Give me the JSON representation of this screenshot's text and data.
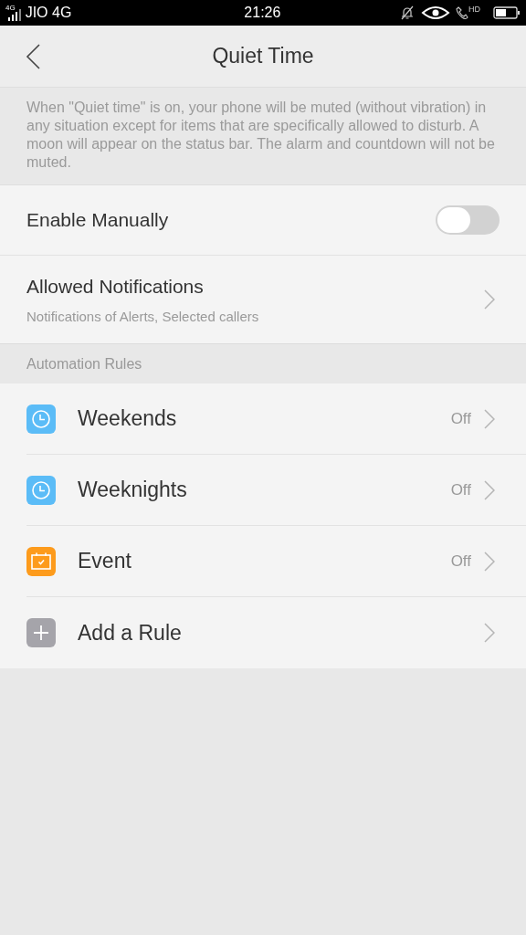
{
  "status_bar": {
    "network": "4G",
    "carrier": "JIO 4G",
    "time": "21:26",
    "hd": "HD"
  },
  "header": {
    "title": "Quiet Time"
  },
  "description": "When \"Quiet time\" is on, your phone will be muted (without vibration) in any situation except for items that are specifically allowed to disturb. A moon will appear on the status bar. The alarm and countdown will not be muted.",
  "settings": [
    {
      "kind": "toggle",
      "label": "Enable Manually",
      "on": false
    },
    {
      "kind": "link",
      "label": "Allowed Notifications",
      "subtitle": "Notifications of Alerts, Selected callers"
    }
  ],
  "automation": {
    "heading": "Automation Rules",
    "rules": [
      {
        "kind": "clock",
        "color": "#5bbcf7",
        "label": "Weekends",
        "status": "Off"
      },
      {
        "kind": "clock",
        "color": "#5bbcf7",
        "label": "Weeknights",
        "status": "Off"
      },
      {
        "kind": "calendar",
        "color": "#fd9b1c",
        "label": "Event",
        "status": "Off"
      },
      {
        "kind": "plus",
        "color": "#a5a4aa",
        "label": "Add a Rule"
      }
    ]
  }
}
